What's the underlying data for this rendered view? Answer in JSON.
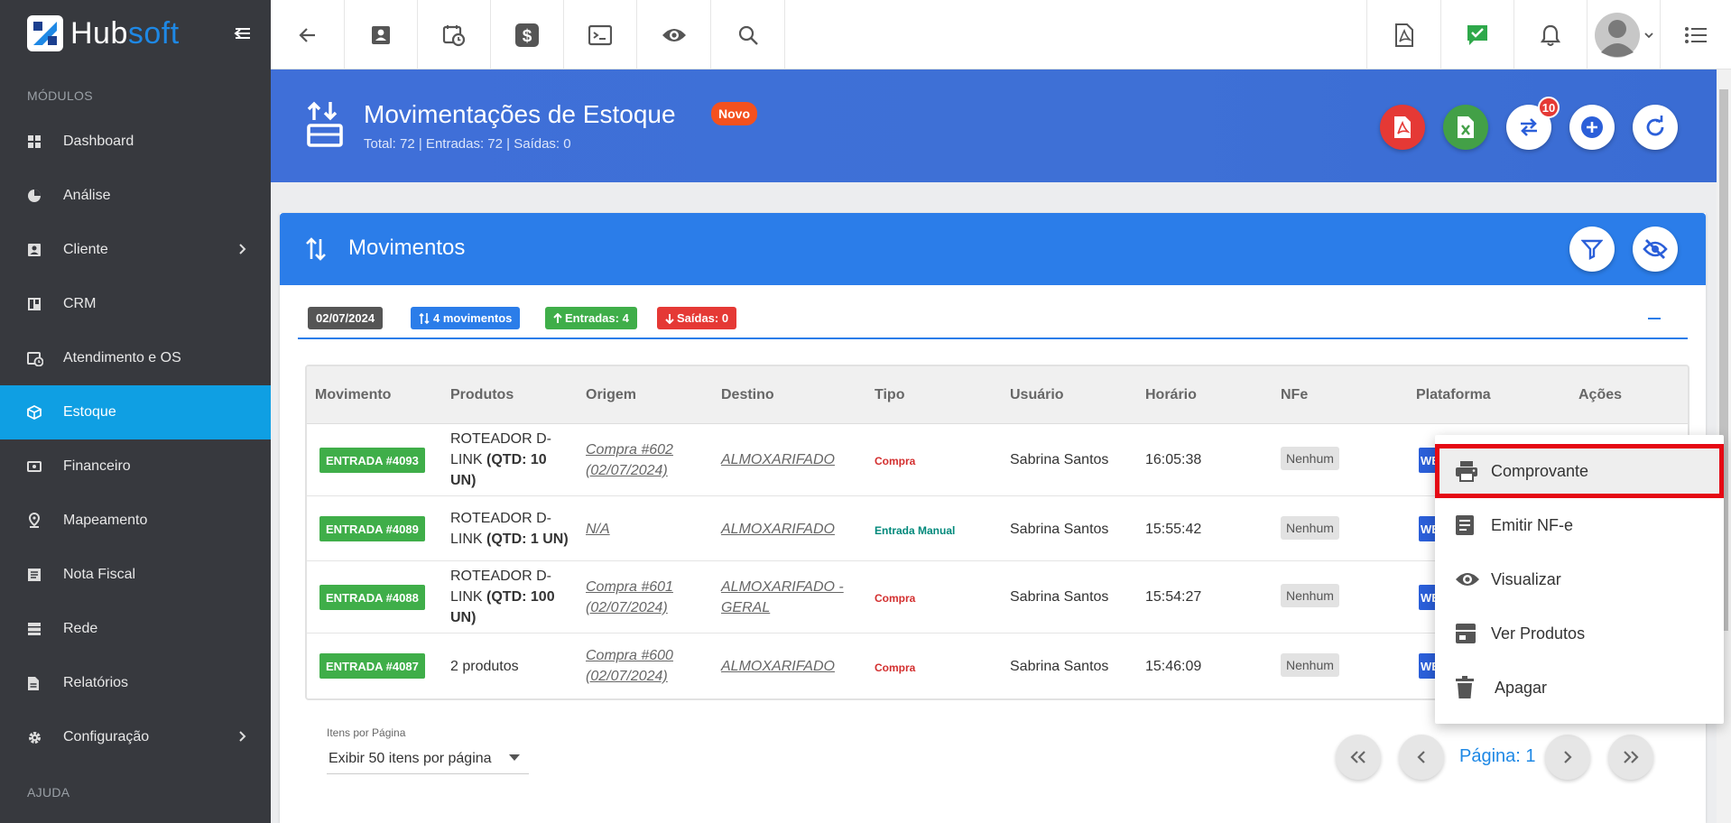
{
  "app": {
    "brand_a": "Hub",
    "brand_b": "soft"
  },
  "sidebar": {
    "section_modules": "MÓDULOS",
    "section_help": "AJUDA",
    "items": [
      {
        "label": "Dashboard",
        "icon": "dashboard-icon"
      },
      {
        "label": "Análise",
        "icon": "pie-chart-icon"
      },
      {
        "label": "Cliente",
        "icon": "contact-card-icon"
      },
      {
        "label": "CRM",
        "icon": "board-icon"
      },
      {
        "label": "Atendimento e OS",
        "icon": "calendar-clock-icon"
      },
      {
        "label": "Estoque",
        "icon": "box-icon"
      },
      {
        "label": "Financeiro",
        "icon": "money-icon"
      },
      {
        "label": "Mapeamento",
        "icon": "map-pin-icon"
      },
      {
        "label": "Nota Fiscal",
        "icon": "document-icon"
      },
      {
        "label": "Rede",
        "icon": "server-icon"
      },
      {
        "label": "Relatórios",
        "icon": "report-icon"
      },
      {
        "label": "Configuração",
        "icon": "gear-icon"
      }
    ]
  },
  "header": {
    "title": "Movimentações de Estoque",
    "badge": "Novo",
    "subtitle": "Total: 72 | Entradas: 72 | Saídas: 0",
    "swap_count": "10"
  },
  "card": {
    "title": "Movimentos"
  },
  "chips": {
    "date": "02/07/2024",
    "movements": "4 movimentos",
    "entries": "Entradas: 4",
    "exits": "Saídas: 0"
  },
  "table": {
    "headers": [
      "Movimento",
      "Produtos",
      "Origem",
      "Destino",
      "Tipo",
      "Usuário",
      "Horário",
      "NFe",
      "Plataforma",
      "Ações"
    ],
    "rows": [
      {
        "mov": "ENTRADA #4093",
        "prod_a": "ROTEADOR D-",
        "prod_b": "LINK ",
        "prod_bold": "(QTD: 10",
        "prod_bold2": "UN)",
        "origem_a": "Compra #602",
        "origem_b": "(02/07/2024)",
        "destino_a": "ALMOXARIFADO",
        "destino_b": "",
        "tipo": "Compra",
        "usuario": "Sabrina Santos",
        "horario": "16:05:38",
        "nfe": "Nenhum",
        "plataforma": "WEB"
      },
      {
        "mov": "ENTRADA #4089",
        "prod_a": "ROTEADOR D-",
        "prod_b": "LINK ",
        "prod_bold": "(QTD: 1 UN)",
        "prod_bold2": "",
        "origem_a": "N/A",
        "origem_b": "",
        "destino_a": "ALMOXARIFADO",
        "destino_b": "",
        "tipo": "Entrada Manual",
        "usuario": "Sabrina Santos",
        "horario": "15:55:42",
        "nfe": "Nenhum",
        "plataforma": "WEB"
      },
      {
        "mov": "ENTRADA #4088",
        "prod_a": "ROTEADOR D-",
        "prod_b": "LINK ",
        "prod_bold": "(QTD: 100",
        "prod_bold2": "UN)",
        "origem_a": "Compra #601",
        "origem_b": "(02/07/2024)",
        "destino_a": "ALMOXARIFADO -",
        "destino_b": "GERAL",
        "tipo": "Compra",
        "usuario": "Sabrina Santos",
        "horario": "15:54:27",
        "nfe": "Nenhum",
        "plataforma": "WEB"
      },
      {
        "mov": "ENTRADA #4087",
        "prod_a": "2 produtos",
        "prod_b": "",
        "prod_bold": "",
        "prod_bold2": "",
        "origem_a": "Compra #600",
        "origem_b": "(02/07/2024)",
        "destino_a": "ALMOXARIFADO",
        "destino_b": "",
        "tipo": "Compra",
        "usuario": "Sabrina Santos",
        "horario": "15:46:09",
        "nfe": "Nenhum",
        "plataforma": "WEB"
      }
    ]
  },
  "pagination": {
    "per_page_label": "Itens por Página",
    "per_page_value": "Exibir 50 itens por página",
    "page": "Página: 1"
  },
  "menu": {
    "items": [
      {
        "label": "Comprovante",
        "icon": "printer-icon"
      },
      {
        "label": "Emitir NF-e",
        "icon": "document-icon"
      },
      {
        "label": "Visualizar",
        "icon": "eye-icon"
      },
      {
        "label": "Ver Produtos",
        "icon": "package-icon"
      },
      {
        "label": "Apagar",
        "icon": "trash-icon"
      }
    ]
  },
  "colors": {
    "sidebar": "#37393e",
    "active": "#0f9fe3",
    "hero": "#3f6fd8",
    "card_head": "#2b7de9",
    "entrada": "#3fae49",
    "highlight": "#e50914"
  }
}
